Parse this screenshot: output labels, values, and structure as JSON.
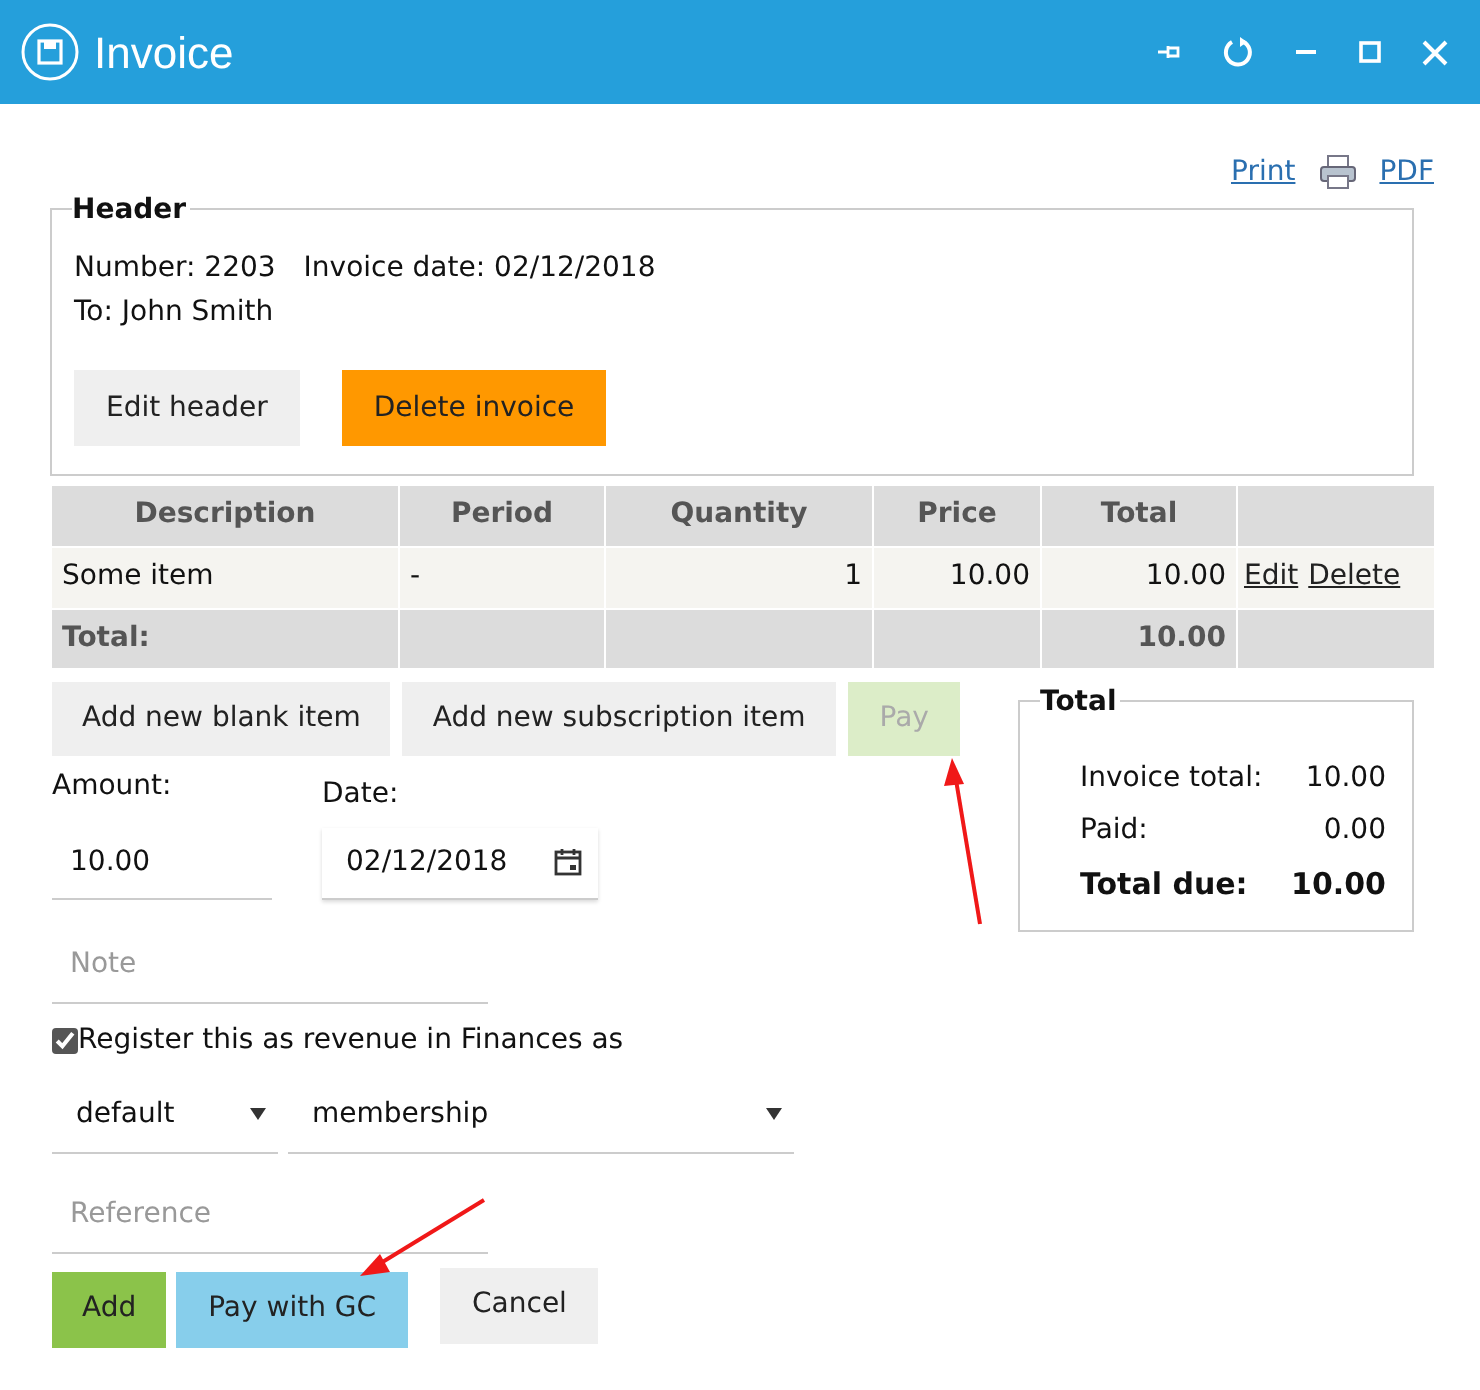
{
  "window": {
    "title": "Invoice"
  },
  "links": [
    {
      "label": "Print",
      "kind": "print"
    },
    {
      "label": "PDF",
      "kind": "plain"
    }
  ],
  "header": {
    "legend": "Header",
    "number": "Number: 2203",
    "invoice_date": "Invoice date: 02/12/2018",
    "to": "To: John Smith",
    "buttons": [
      {
        "label": "Edit header",
        "kind": "default"
      },
      {
        "label": "Delete invoice",
        "kind": "warning"
      }
    ]
  },
  "table": {
    "columns": [
      "Description",
      "Period",
      "Quantity",
      "Price",
      "Total"
    ],
    "rows": [
      {
        "cells": [
          "Some item",
          "-",
          "1",
          "10.00",
          "10.00"
        ],
        "actions": [
          "Edit",
          "Delete"
        ]
      }
    ],
    "total_row": {
      "label": "Total:",
      "total": "10.00"
    }
  },
  "item_buttons": [
    {
      "label": "Add new blank item",
      "disabled": false
    },
    {
      "label": "Add new subscription item",
      "disabled": false
    },
    {
      "label": "Pay",
      "disabled": true
    }
  ],
  "payment": {
    "amount": {
      "label": "Amount:",
      "value": "10.00"
    },
    "date": {
      "label": "Date:",
      "value": "02/12/2018"
    },
    "note": {
      "placeholder": "Note"
    },
    "register": {
      "label": "Register this as revenue in Finances as",
      "checked": true
    },
    "account": {
      "value": "default"
    },
    "category": {
      "value": "membership"
    },
    "reference": {
      "placeholder": "Reference"
    },
    "actions": [
      {
        "label": "Add",
        "kind": "success"
      },
      {
        "label": "Pay with GC",
        "kind": "info"
      },
      {
        "label": "Cancel",
        "kind": "default"
      }
    ]
  },
  "totals": {
    "legend": "Total",
    "rows": [
      {
        "label": "Invoice total:",
        "value": "10.00",
        "kind": "line"
      },
      {
        "label": "Paid:",
        "value": "0.00",
        "kind": "line"
      },
      {
        "label": "Total due:",
        "value": "10.00",
        "kind": "summary"
      }
    ]
  }
}
